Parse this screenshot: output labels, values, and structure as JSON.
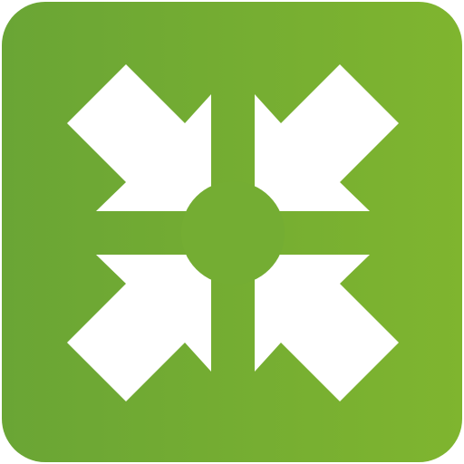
{
  "icon": {
    "name": "collapse-arrows-icon",
    "description_label": "",
    "colors": {
      "tile_left": "#6aa535",
      "tile_right": "#7fb52f",
      "glyph": "#ffffff"
    }
  }
}
